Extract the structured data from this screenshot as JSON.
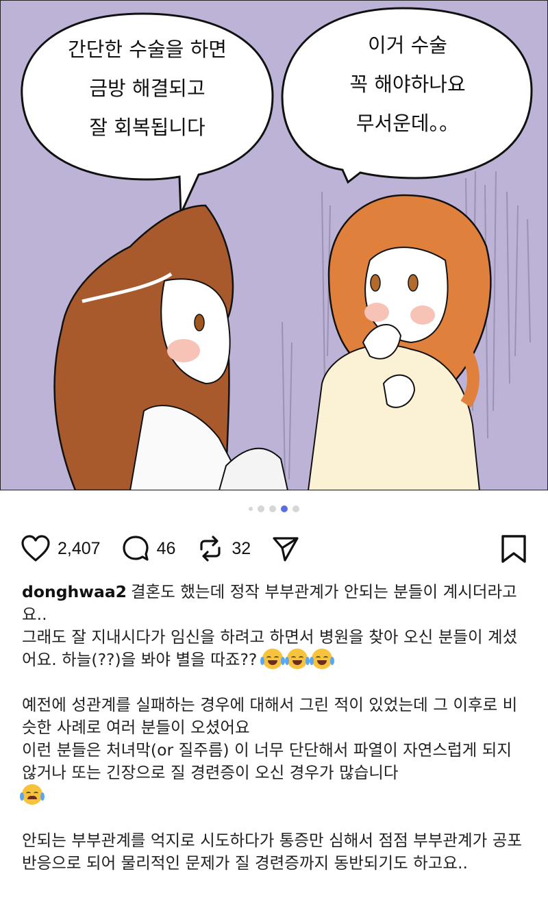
{
  "comic": {
    "bubble_left": "간단한 수술을 하면\n금방 해결되고\n잘 회복됩니다",
    "bubble_right": "이거 수술\n꼭 해야하나요\n무서운데。。"
  },
  "carousel": {
    "total": 5,
    "active_index": 3
  },
  "actions": {
    "likes": "2,407",
    "comments": "46",
    "reposts": "32"
  },
  "caption": {
    "username": "donghwaa2",
    "para1_text": "결혼도 했는데 정작 부부관계가 안되는 분들이 계시더라고요..\n그래도 잘 지내시다가 임신을 하려고 하면서 병원을 찾아 오신 분들이 계셨어요. 하늘(??)을 봐야 별을 따죠??",
    "para2_text": "예전에 성관계를 실패하는 경우에 대해서 그린 적이 있었는데 그 이후로 비슷한 사례로 여러 분들이 오셨어요\n이런 분들은 처녀막(or 질주름) 이 너무 단단해서 파열이 자연스럽게 되지 않거나 또는 긴장으로 질 경련증이 오신 경우가 많습니다",
    "para3_text": "안되는 부부관계를 억지로 시도하다가 통증만 심해서 점점 부부관계가 공포반응으로 되어 물리적인 문제가 질 경련증까지 동반되기도 하고요.."
  },
  "icons": {
    "emoji_laugh": "face-with-tears-of-joy",
    "emoji_cry": "loudly-crying-face"
  },
  "colors": {
    "background_purple": "#bdb3d6",
    "active_dot": "#5b6ee1"
  }
}
